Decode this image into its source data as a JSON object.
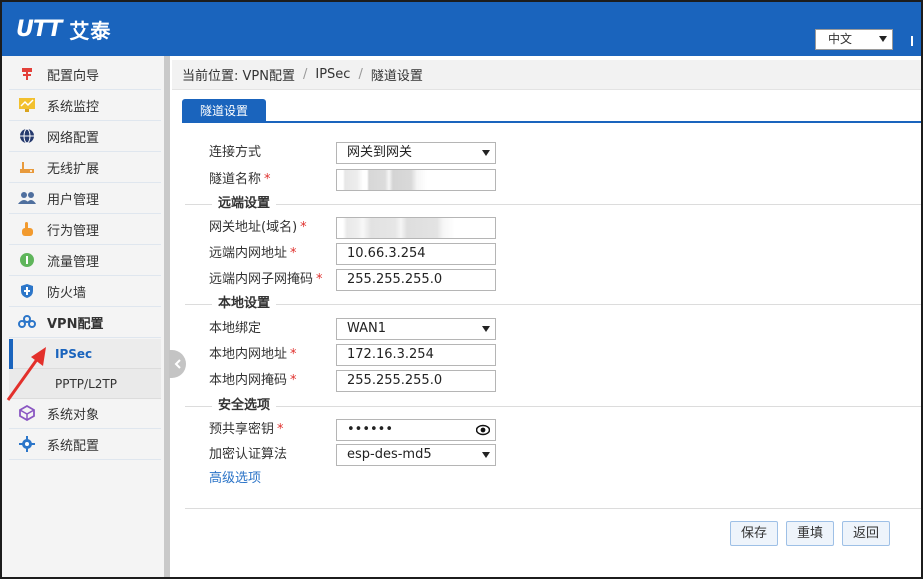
{
  "header": {
    "logo_mark": "UTT",
    "logo_text": "艾泰",
    "language": "中文",
    "brand_color": "#1a64bd"
  },
  "sidebar": {
    "items": [
      {
        "label": "配置向导",
        "icon": "pin-icon"
      },
      {
        "label": "系统监控",
        "icon": "monitor-chart-icon"
      },
      {
        "label": "网络配置",
        "icon": "globe-icon"
      },
      {
        "label": "无线扩展",
        "icon": "wireless-router-icon"
      },
      {
        "label": "用户管理",
        "icon": "users-icon"
      },
      {
        "label": "行为管理",
        "icon": "hand-pointer-icon"
      },
      {
        "label": "流量管理",
        "icon": "traffic-icon"
      },
      {
        "label": "防火墙",
        "icon": "shield-icon"
      },
      {
        "label": "VPN配置",
        "icon": "vpn-link-icon"
      },
      {
        "label": "系统对象",
        "icon": "cube-icon"
      },
      {
        "label": "系统配置",
        "icon": "gear-icon"
      }
    ],
    "vpn_sub": [
      {
        "label": "IPSec",
        "active": true
      },
      {
        "label": "PPTP/L2TP",
        "active": false
      }
    ]
  },
  "breadcrumb": {
    "prefix": "当前位置: VPN配置",
    "sep": "/",
    "level2": "IPSec",
    "level3": "隧道设置"
  },
  "tab": {
    "label": "隧道设置"
  },
  "form": {
    "connection_type": {
      "label": "连接方式",
      "value": "网关到网关"
    },
    "tunnel_name": {
      "label": "隧道名称",
      "value": ""
    },
    "remote_section": "远端设置",
    "gateway_address": {
      "label": "网关地址(域名)",
      "value": ""
    },
    "remote_lan_ip": {
      "label": "远端内网地址",
      "value": "10.66.3.254"
    },
    "remote_lan_mask": {
      "label": "远端内网子网掩码",
      "value": "255.255.255.0"
    },
    "local_section": "本地设置",
    "local_binding": {
      "label": "本地绑定",
      "value": "WAN1"
    },
    "local_lan_ip": {
      "label": "本地内网地址",
      "value": "172.16.3.254"
    },
    "local_lan_mask": {
      "label": "本地内网掩码",
      "value": "255.255.255.0"
    },
    "security_section": "安全选项",
    "preshared_key": {
      "label": "预共享密钥",
      "value": "••••••"
    },
    "encryption_algorithm": {
      "label": "加密认证算法",
      "value": "esp-des-md5"
    },
    "advanced_link": "高级选项",
    "required_mark": "*"
  },
  "buttons": {
    "save": "保存",
    "reset": "重填",
    "back": "返回"
  }
}
